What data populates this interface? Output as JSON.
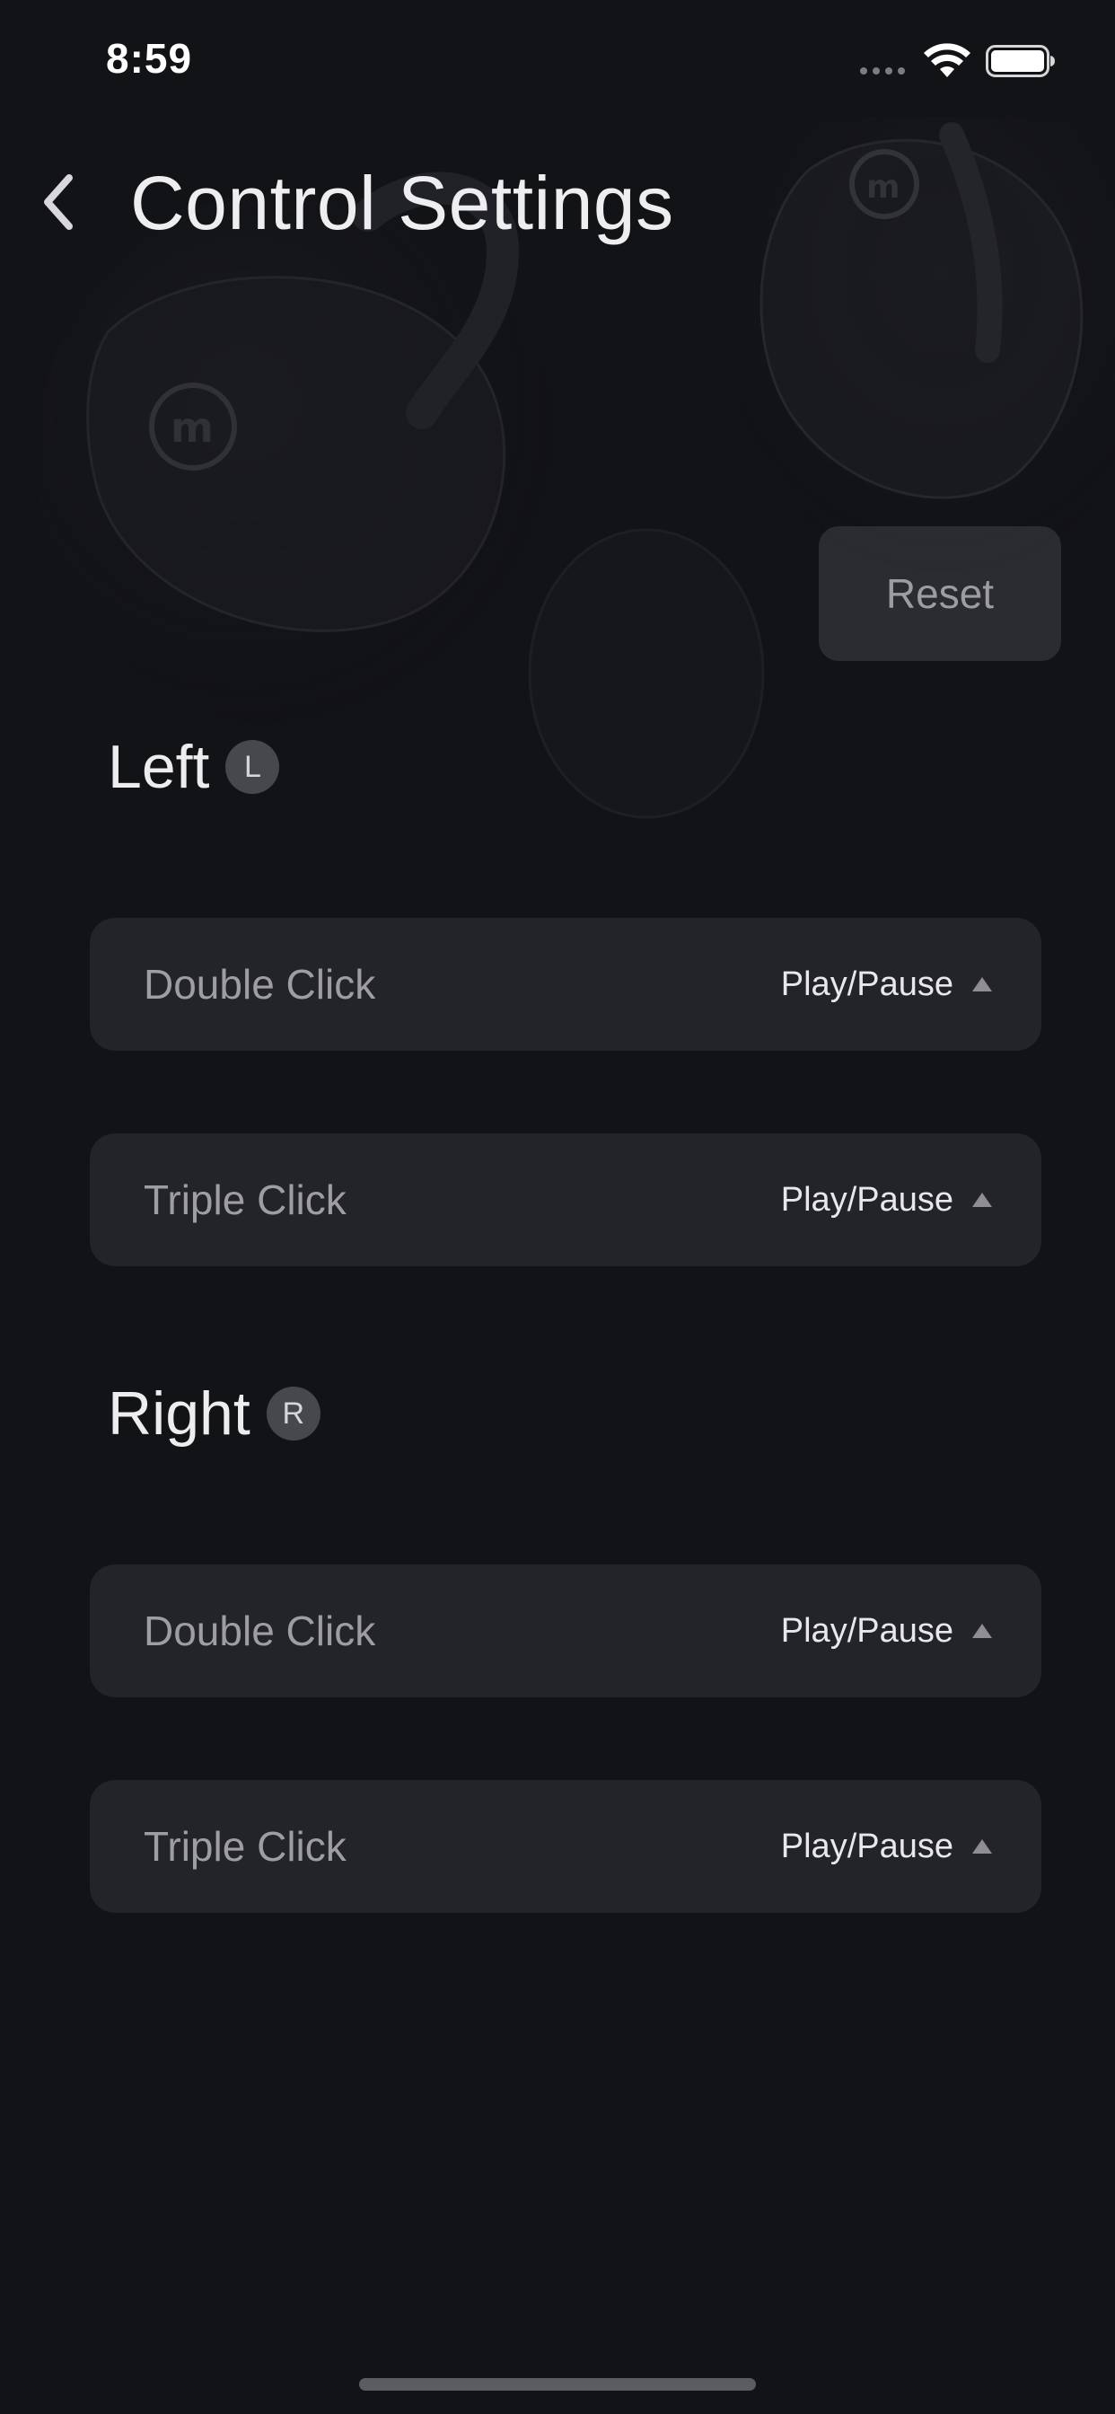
{
  "status_bar": {
    "time": "8:59",
    "icons": [
      "cellular-signal-icon",
      "wifi-icon",
      "battery-icon"
    ]
  },
  "header": {
    "back_icon": "chevron-left-icon",
    "title": "Control Settings"
  },
  "reset_label": "Reset",
  "sections": [
    {
      "title": "Left",
      "badge": "L",
      "rows": [
        {
          "label": "Double Click",
          "value": "Play/Pause"
        },
        {
          "label": "Triple Click",
          "value": "Play/Pause"
        }
      ]
    },
    {
      "title": "Right",
      "badge": "R",
      "rows": [
        {
          "label": "Double Click",
          "value": "Play/Pause"
        },
        {
          "label": "Triple Click",
          "value": "Play/Pause"
        }
      ]
    }
  ],
  "colors": {
    "background": "#121317",
    "row_background": "#232428",
    "badge_background": "#47484d",
    "reset_text": "#9c9ca2"
  }
}
